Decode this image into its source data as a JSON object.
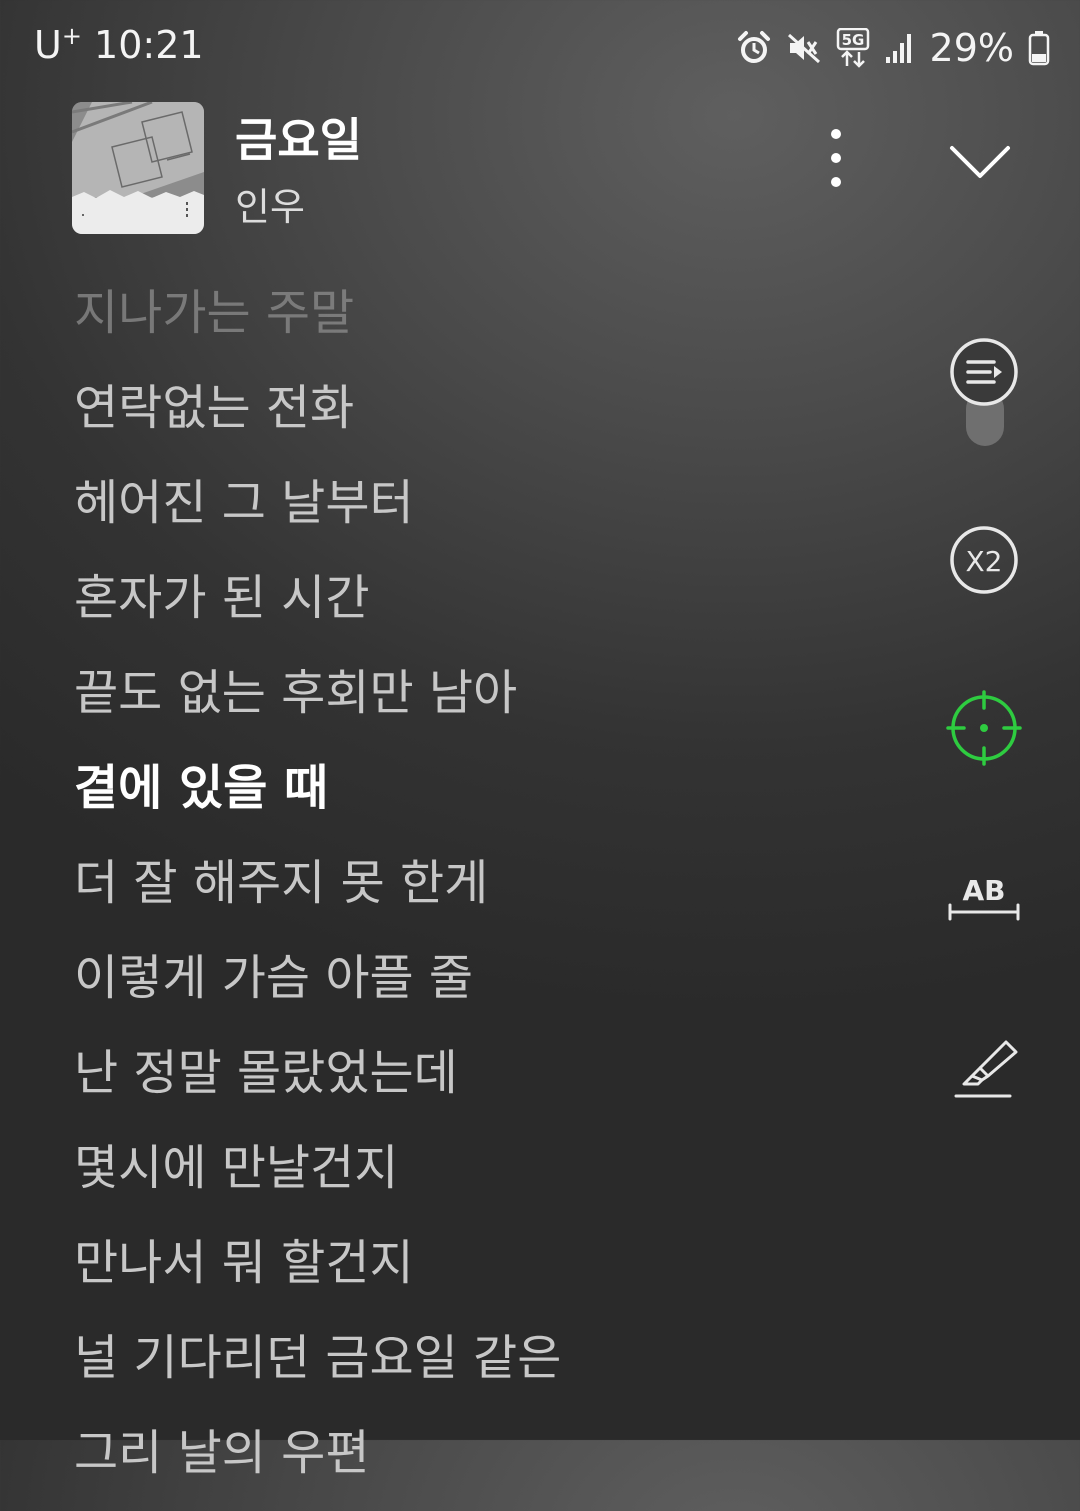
{
  "status_bar": {
    "carrier": "U",
    "carrier_sup": "+",
    "time": "10:21",
    "network_badge": "5G",
    "battery_percent": "29%",
    "icons": [
      "alarm-icon",
      "mute-icon",
      "5g-data-icon",
      "signal-icon",
      "battery-icon"
    ]
  },
  "header": {
    "title": "금요일",
    "artist": "인우",
    "more_icon": "more-vertical-icon",
    "collapse_icon": "chevron-down-icon"
  },
  "lyrics": {
    "lines": [
      "지나가는 주말",
      "연락없는 전화",
      "헤어진 그 날부터",
      "혼자가 된 시간",
      "끝도 없는 후회만 남아",
      "곁에 있을 때",
      "더 잘 해주지 못 한게",
      "이렇게 가슴 아플 줄",
      "난 정말 몰랐었는데",
      "몇시에 만날건지",
      "만나서 뭐 할건지",
      "널 기다리던 금요일 같은",
      "그리 날의 우편"
    ],
    "current_index": 5
  },
  "side_controls": {
    "speed_label": "X2",
    "ab_label": "AB",
    "icons": [
      "playlist-icon",
      "speed-x2-icon",
      "sync-lyrics-icon",
      "ab-repeat-icon",
      "highlighter-icon"
    ],
    "sync_color": "#2ecc40"
  },
  "colors": {
    "text_primary": "#ffffff",
    "text_secondary": "#c7c7c7",
    "accent_green": "#2ecc40"
  }
}
